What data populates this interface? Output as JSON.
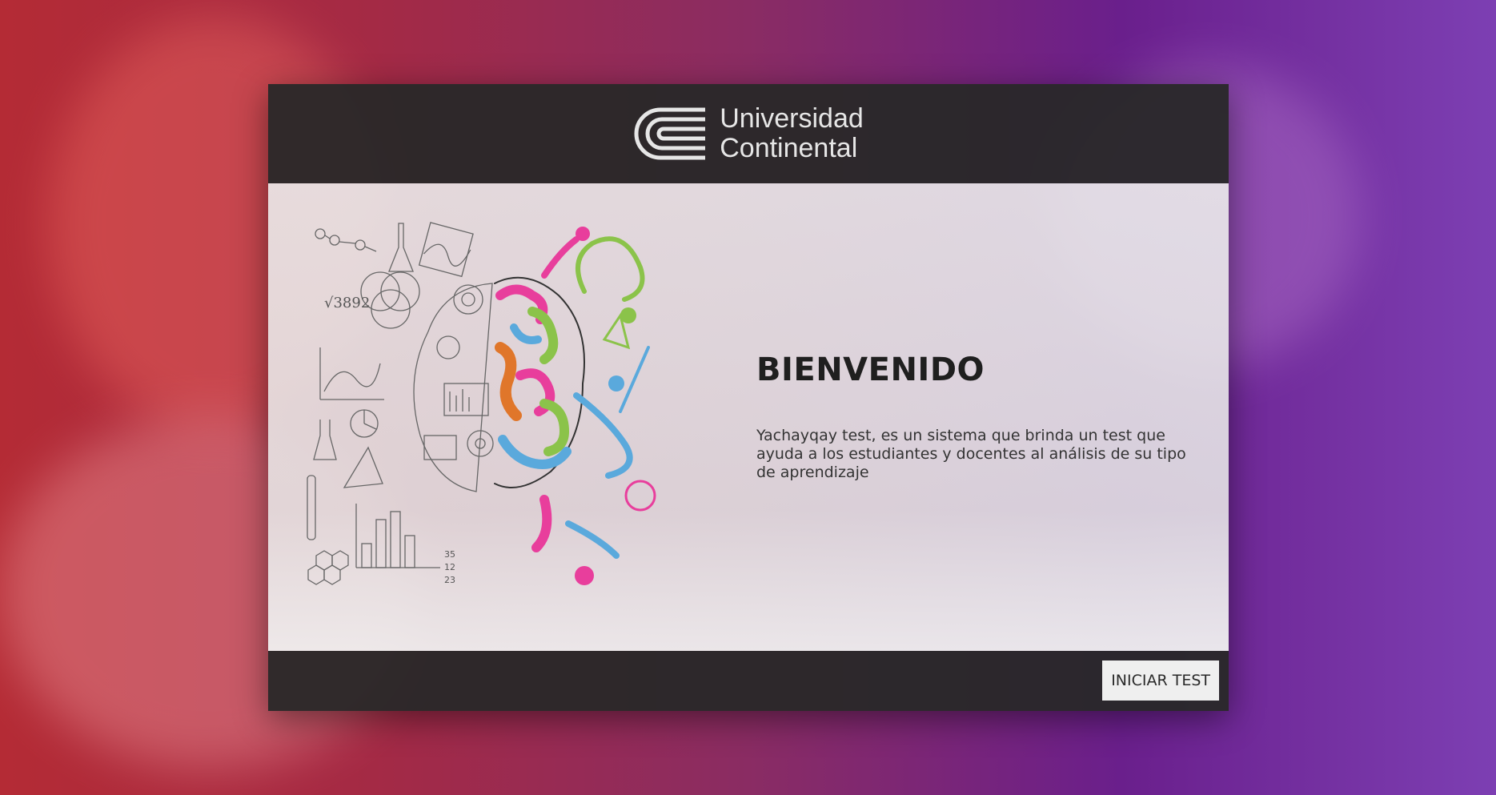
{
  "header": {
    "logo_line1": "Universidad",
    "logo_line2": "Continental",
    "logo_icon": "continental-c-logo-icon"
  },
  "welcome": {
    "title": "BIENVENIDO",
    "description": "Yachayqay test, es un sistema que brinda un test que ayuda a los estudiantes y docentes al análisis de su tipo de aprendizaje"
  },
  "illustration": {
    "icon": "brain-left-right-illustration",
    "sketch_text_1": "√3892",
    "sketch_text_2": "35",
    "sketch_text_3": "12",
    "sketch_text_4": "23"
  },
  "footer": {
    "start_button_label": "INICIAR TEST"
  },
  "colors": {
    "header_bg": "#282828",
    "body_bg": "#e8e8e8",
    "button_bg": "#efefef",
    "background_left": "#b42b35",
    "background_right": "#6a1f8c"
  }
}
